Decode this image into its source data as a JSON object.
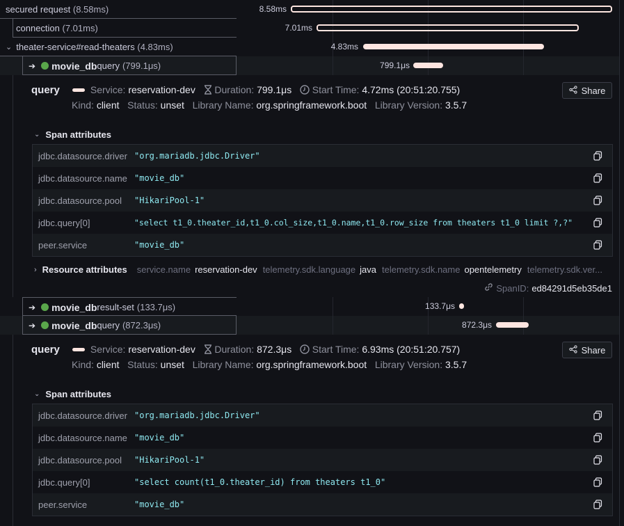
{
  "rows": [
    {
      "name": "secured request",
      "duration": "(8.58ms)",
      "bar_label": "8.58ms"
    },
    {
      "name": "connection",
      "duration": "(7.01ms)",
      "bar_label": "7.01ms"
    },
    {
      "name": "theater-service#read-theaters",
      "duration": "(4.83ms)",
      "bar_label": "4.83ms"
    },
    {
      "service": "movie_db",
      "op": "query",
      "duration": "(799.1μs)",
      "bar_label": "799.1μs"
    },
    {
      "service": "movie_db",
      "op": "result-set",
      "duration": "(133.7μs)",
      "bar_label": "133.7μs"
    },
    {
      "service": "movie_db",
      "op": "query",
      "duration": "(872.3μs)",
      "bar_label": "872.3μs"
    }
  ],
  "detail1": {
    "title": "query",
    "service_key": "Service:",
    "service_val": "reservation-dev",
    "duration_key": "Duration:",
    "duration_val": "799.1μs",
    "start_key": "Start Time:",
    "start_val": "4.72ms (20:51:20.755)",
    "kind_key": "Kind:",
    "kind_val": "client",
    "status_key": "Status:",
    "status_val": "unset",
    "lib_key": "Library Name:",
    "lib_val": "org.springframework.boot",
    "libver_key": "Library Version:",
    "libver_val": "3.5.7",
    "share_label": "Share",
    "span_attr_label": "Span attributes",
    "attrs": [
      {
        "k": "jdbc.datasource.driver",
        "v": "\"org.mariadb.jdbc.Driver\""
      },
      {
        "k": "jdbc.datasource.name",
        "v": "\"movie_db\""
      },
      {
        "k": "jdbc.datasource.pool",
        "v": "\"HikariPool-1\""
      },
      {
        "k": "jdbc.query[0]",
        "v": "\"select t1_0.theater_id,t1_0.col_size,t1_0.name,t1_0.row_size from theaters t1_0 limit ?,?\""
      },
      {
        "k": "peer.service",
        "v": "\"movie_db\""
      }
    ],
    "res_attr_label": "Resource attributes",
    "res_attrs": [
      {
        "k": "service.name",
        "v": "reservation-dev"
      },
      {
        "k": "telemetry.sdk.language",
        "v": "java"
      },
      {
        "k": "telemetry.sdk.name",
        "v": "opentelemetry"
      },
      {
        "k": "telemetry.sdk.ver...",
        "v": ""
      }
    ],
    "spanid_key": "SpanID:",
    "spanid_val": "ed84291d5eb35de1"
  },
  "detail2": {
    "title": "query",
    "service_key": "Service:",
    "service_val": "reservation-dev",
    "duration_key": "Duration:",
    "duration_val": "872.3μs",
    "start_key": "Start Time:",
    "start_val": "6.93ms (20:51:20.757)",
    "kind_key": "Kind:",
    "kind_val": "client",
    "status_key": "Status:",
    "status_val": "unset",
    "lib_key": "Library Name:",
    "lib_val": "org.springframework.boot",
    "libver_key": "Library Version:",
    "libver_val": "3.5.7",
    "share_label": "Share",
    "span_attr_label": "Span attributes",
    "attrs": [
      {
        "k": "jdbc.datasource.driver",
        "v": "\"org.mariadb.jdbc.Driver\""
      },
      {
        "k": "jdbc.datasource.name",
        "v": "\"movie_db\""
      },
      {
        "k": "jdbc.datasource.pool",
        "v": "\"HikariPool-1\""
      },
      {
        "k": "jdbc.query[0]",
        "v": "\"select count(t1_0.theater_id) from theaters t1_0\""
      },
      {
        "k": "peer.service",
        "v": "\"movie_db\""
      }
    ]
  },
  "colors": {
    "accent_bar": "#fde5e0",
    "service_dot": "#5aa64b",
    "attr_value": "#8ee8f0"
  },
  "icons": {
    "expand": "arrow-right-icon",
    "collapse": "chevron-down-icon",
    "copy": "copy-icon",
    "share": "share-icon",
    "link": "link-icon",
    "hourglass": "hourglass-icon",
    "clock": "clock-icon"
  }
}
